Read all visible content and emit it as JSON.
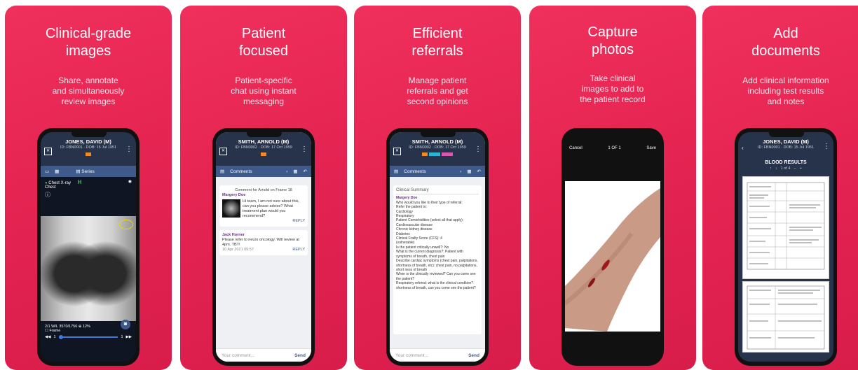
{
  "panels": [
    {
      "title_line1": "Clinical-grade",
      "title_line2": "images",
      "sub_line1": "Share, annotate",
      "sub_line2": "and simultaneously",
      "sub_line3": "review images"
    },
    {
      "title_line1": "Patient",
      "title_line2": "focused",
      "sub_line1": "Patient-specific",
      "sub_line2": "chat using instant",
      "sub_line3": "messaging"
    },
    {
      "title_line1": "Efficient",
      "title_line2": "referrals",
      "sub_line1": "Manage patient",
      "sub_line2": "referrals and get",
      "sub_line3": "second opinions"
    },
    {
      "title_line1": "Capture",
      "title_line2": "photos",
      "sub_line1": "Take clinical",
      "sub_line2": "images to add to",
      "sub_line3": "the patient record"
    },
    {
      "title_line1": "Add",
      "title_line2": "documents",
      "sub_line1": "Add clinical information",
      "sub_line2": "including test results",
      "sub_line3": "and notes"
    }
  ],
  "phone1": {
    "patient": "JONES, DAVID (M)",
    "ids": "ID: FBN0001 · DOB: 15 Jul 1951",
    "tab_series": "Series",
    "series_name": "Chest X-ray",
    "series_sub": "Chest",
    "h_marker": "H",
    "info": "2/1  W/L 3570/1756  ⊕ 12%",
    "frame": "Frame",
    "slider_start": "1",
    "slider_end": "1"
  },
  "phone2": {
    "patient": "SMITH, ARNOLD (M)",
    "ids": "ID: FBN0002 · DOB: 17 Oct 1959",
    "tab_comments": "Comments",
    "card1_title": "Comment for Arnold on Frame 18",
    "card1_author": "Margery Doe",
    "card1_text": "Hi team, I am not sure about this, can you please advise? What treatment plan would you recommend?",
    "card1_reply": "REPLY",
    "card2_author": "Jack Horner",
    "card2_text": "Please refer to neuro oncology. Will review at 4pm. TBT!",
    "card2_date": "10 Apr 2021 05:57",
    "card2_reply": "REPLY",
    "placeholder": "Your comment...",
    "send": "Send"
  },
  "phone3": {
    "patient": "SMITH, ARNOLD (M)",
    "ids": "ID: FBN0002 · DOB: 17 Oct 1959",
    "tab_comments": "Comments",
    "summary_title": "Clinical Summary",
    "author": "Margery Doe",
    "lines": [
      "Who would you like to their type of referral:",
      "Refer the patient to:",
      "    Cardiology",
      "    Respiratory",
      "Patient Comorbidities (select all that apply):",
      "    Cardiovascular disease",
      "    Chronic kidney disease",
      "    Diabetes",
      "Clinical Frailty Score (CFS): 4",
      "(vulnerable)",
      "Is the patient critically unwell?: No",
      "What is the current diagnosis?: Patient with symptoms of breath, chest pain",
      "Describe cardiac symptoms (chest pain, palpitations, shortness of breath, etc): chest pain, no palpitations, short ness of breath",
      "When is the clinically reviewed? Can you come see the patient?",
      "Respiratory referral: what is the clinical condition? shortness of breath, can you come see the patient?"
    ],
    "placeholder": "Your comment...",
    "send": "Send"
  },
  "phone4": {
    "cancel": "Cancel",
    "counter": "1 OF 1",
    "save": "Save"
  },
  "phone5": {
    "patient": "JONES, DAVID (M)",
    "ids": "ID: FBN0001 · DOB: 15 Jul 1951",
    "doc_title": "BLOOD RESULTS",
    "pager": "1 of 4"
  }
}
